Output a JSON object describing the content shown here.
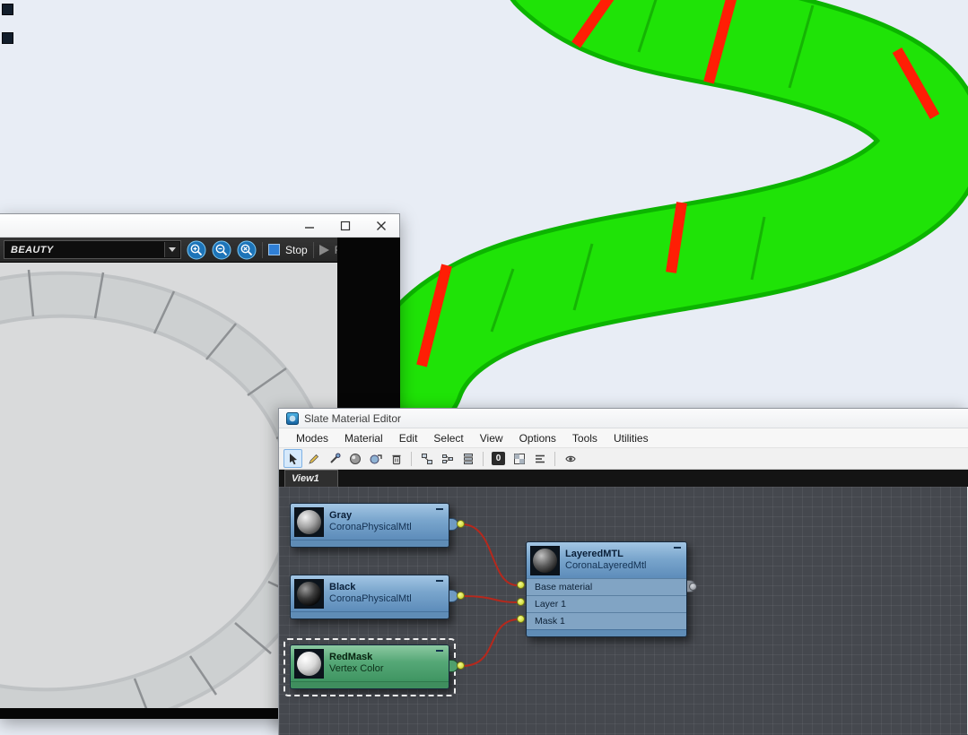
{
  "viewport": {
    "bg_color": "#e8edf5",
    "tube_color": "#1fe307",
    "stripe_color": "#ff1e05"
  },
  "render_window": {
    "channel_selector": {
      "value": "BEAUTY"
    },
    "stop_button": "Stop",
    "render_button": "Render"
  },
  "material_editor": {
    "title": "Slate Material Editor",
    "menu": {
      "items": [
        "Modes",
        "Material",
        "Edit",
        "Select",
        "View",
        "Options",
        "Tools",
        "Utilities"
      ]
    },
    "view_tab": "View1",
    "toolbar": {
      "zero_badge": "0"
    },
    "nodes": {
      "gray": {
        "title": "Gray",
        "subtitle": "CoronaPhysicalMtl"
      },
      "black": {
        "title": "Black",
        "subtitle": "CoronaPhysicalMtl"
      },
      "redmask": {
        "title": "RedMask",
        "subtitle": "Vertex Color"
      },
      "layered": {
        "title": "LayeredMTL",
        "subtitle": "CoronaLayeredMtl",
        "slots": [
          "Base material",
          "Layer 1",
          "Mask 1"
        ]
      }
    }
  }
}
